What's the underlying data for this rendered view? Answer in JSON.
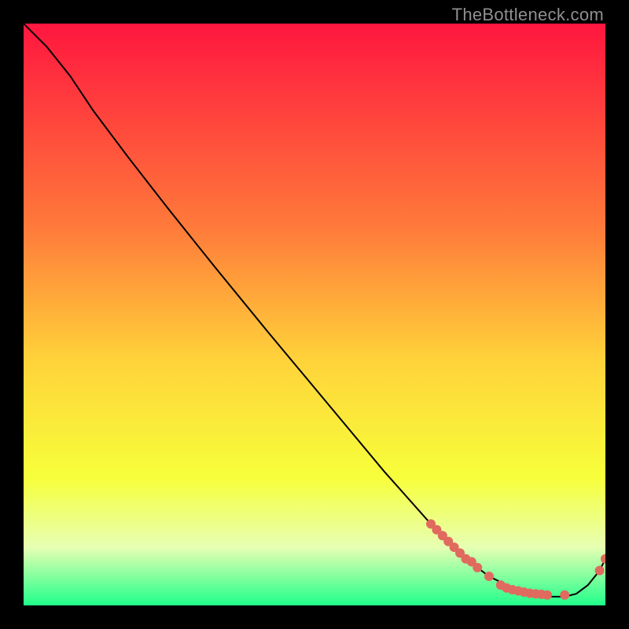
{
  "watermark": "TheBottleneck.com",
  "colors": {
    "gradient_top": "#ff163f",
    "gradient_upper_mid": "#ff7a3a",
    "gradient_mid": "#ffd33a",
    "gradient_lower_mid": "#f7ff3a",
    "gradient_pale": "#e7ffb3",
    "gradient_bottom": "#20ff8a",
    "curve": "#000000",
    "marker": "#e06a5e"
  },
  "chart_data": {
    "type": "line",
    "title": "",
    "xlabel": "",
    "ylabel": "",
    "xlim": [
      0,
      100
    ],
    "ylim": [
      0,
      100
    ],
    "series": [
      {
        "name": "bottleneck-curve",
        "x": [
          0,
          4,
          8,
          12,
          18,
          25,
          33,
          42,
          52,
          62,
          70,
          76,
          80,
          84,
          87,
          90,
          93,
          95,
          97,
          99,
          100
        ],
        "y": [
          100,
          96,
          91,
          85,
          77,
          68,
          58,
          47,
          35,
          23,
          14,
          8,
          5,
          3,
          2,
          1.5,
          1.5,
          2,
          3.5,
          6,
          8
        ]
      }
    ],
    "markers": {
      "name": "highlighted-points",
      "x": [
        70,
        71,
        72,
        73,
        74,
        75,
        76,
        77,
        78,
        80,
        82,
        83,
        84,
        85,
        86,
        87,
        88,
        89,
        90,
        93,
        99,
        100
      ],
      "y": [
        14,
        13,
        12,
        11,
        10,
        9,
        8,
        7.5,
        6.5,
        5,
        3.5,
        3,
        2.7,
        2.5,
        2.3,
        2.1,
        2,
        1.9,
        1.8,
        1.8,
        6,
        8
      ]
    }
  }
}
